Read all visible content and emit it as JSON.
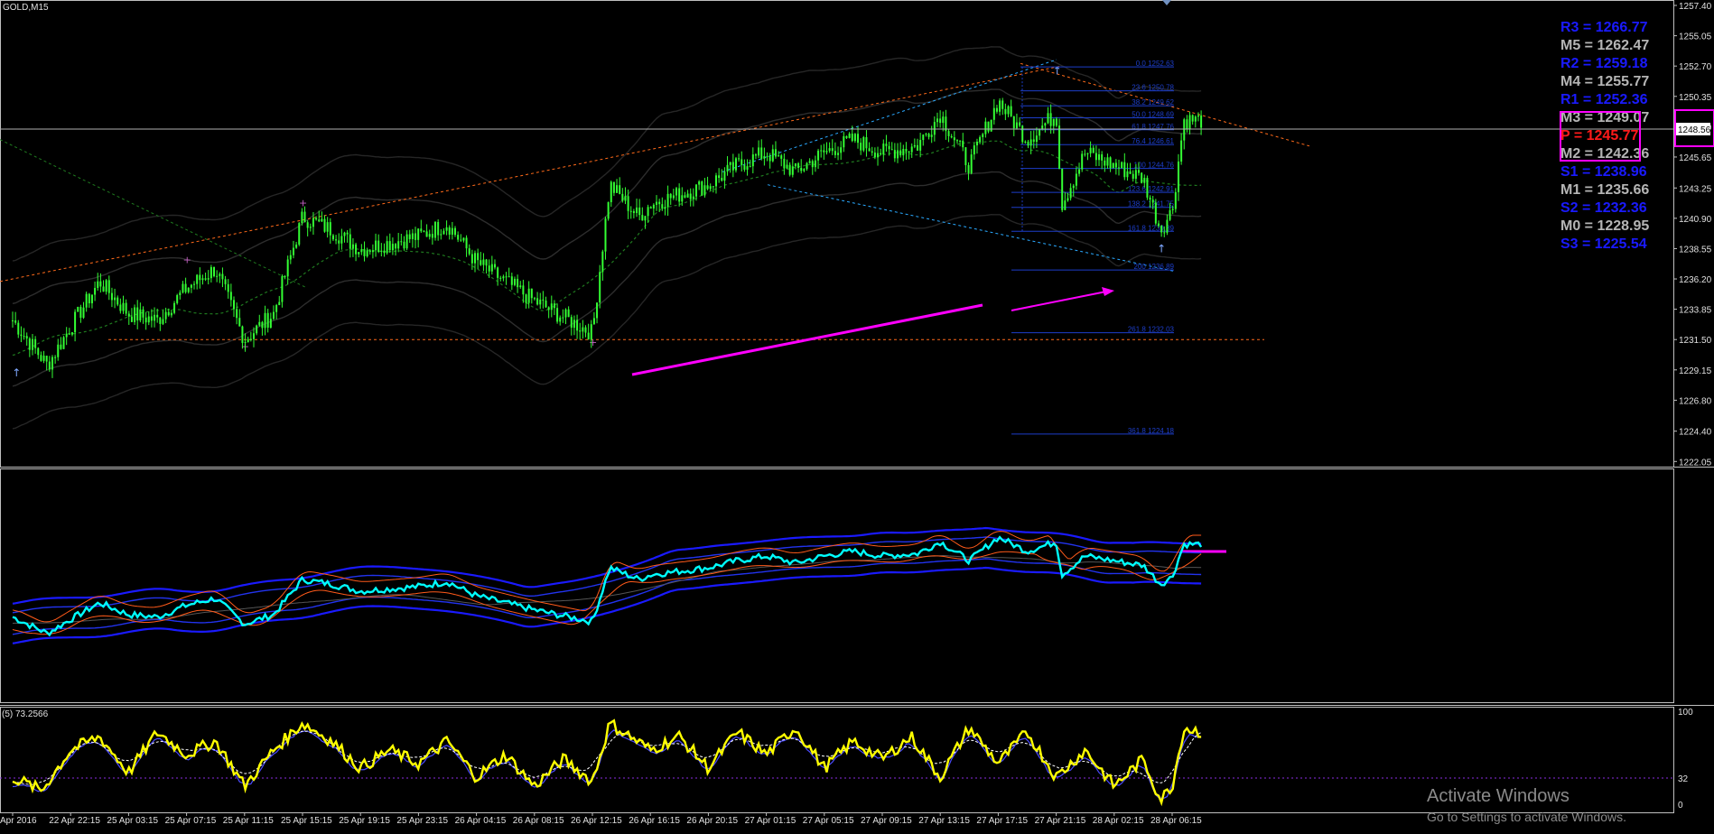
{
  "window": {
    "symbol_title": "GOLD,M15",
    "current_price_label": "1248.56"
  },
  "colors": {
    "background": "#000000",
    "candles": "#33ff33",
    "pivot_blue": "#1a1aff",
    "pivot_gray": "#b5b5b5",
    "pivot_red": "#ff1a1a",
    "highlight": "#ff00ff",
    "trend_orange": "#ff6a1a",
    "channel_cyan": "#2aa9ff",
    "rsi_cyan": "#00ffff",
    "stoch_yellow": "#ffff00"
  },
  "pivots": [
    {
      "label": "R3 = 1266.77",
      "color": "blue"
    },
    {
      "label": "M5 = 1262.47",
      "color": "gray"
    },
    {
      "label": "R2 = 1259.18",
      "color": "blue"
    },
    {
      "label": "M4 = 1255.77",
      "color": "gray"
    },
    {
      "label": "R1 = 1252.36",
      "color": "blue"
    },
    {
      "label": "M3 = 1249.07",
      "color": "gray"
    },
    {
      "label": "P = 1245.77",
      "color": "red"
    },
    {
      "label": "M2 = 1242.36",
      "color": "gray"
    },
    {
      "label": "S1 = 1238.96",
      "color": "blue"
    },
    {
      "label": "M1 = 1235.66",
      "color": "gray"
    },
    {
      "label": "S2 = 1232.36",
      "color": "blue"
    },
    {
      "label": "M0 = 1228.95",
      "color": "gray"
    },
    {
      "label": "S3 = 1225.54",
      "color": "blue"
    }
  ],
  "fib_levels": [
    "0.0 1252.63",
    "23.6 1250.78",
    "38.2 1249.62",
    "50.0 1248.69",
    "61.8 1247.76",
    "76.4 1246.61",
    "100 1244.76",
    "123.6 1242.91",
    "138.2 1241.75",
    "161.8 1239.89",
    "200 1236.89",
    "261.8 1232.03",
    "361.8 1224.18"
  ],
  "oscillator": {
    "label": "(5) 73.2566",
    "ticks": [
      "100",
      "32",
      "0"
    ]
  },
  "chart_data": [
    {
      "type": "candlestick",
      "title": "GOLD,M15",
      "ylim": [
        1222.0,
        1257.4
      ],
      "ylabel_ticks": [
        "1257.40",
        "1255.05",
        "1252.70",
        "1250.35",
        "1248.00",
        "1245.65",
        "1243.25",
        "1240.90",
        "1238.55",
        "1236.20",
        "1233.85",
        "1231.50",
        "1229.15",
        "1226.80",
        "1224.40",
        "1222.05"
      ],
      "x_ticks": [
        "Apr 2016",
        "22 Apr 22:15",
        "25 Apr 03:15",
        "25 Apr 07:15",
        "25 Apr 11:15",
        "25 Apr 15:15",
        "25 Apr 19:15",
        "25 Apr 23:15",
        "26 Apr 04:15",
        "26 Apr 08:15",
        "26 Apr 12:15",
        "26 Apr 16:15",
        "26 Apr 20:15",
        "27 Apr 01:15",
        "27 Apr 05:15",
        "27 Apr 09:15",
        "27 Apr 13:15",
        "27 Apr 17:15",
        "27 Apr 21:15",
        "28 Apr 02:15",
        "28 Apr 06:15"
      ],
      "close_anchors": [
        [
          0,
          1233.0
        ],
        [
          0.6,
          1229.5
        ],
        [
          1.0,
          1232.5
        ],
        [
          1.5,
          1236.0
        ],
        [
          2.0,
          1233.5
        ],
        [
          2.5,
          1233.0
        ],
        [
          3.0,
          1235.5
        ],
        [
          3.5,
          1237.0
        ],
        [
          4.0,
          1231.5
        ],
        [
          4.5,
          1233.5
        ],
        [
          5.0,
          1241.0
        ],
        [
          5.5,
          1240.0
        ],
        [
          6.0,
          1238.5
        ],
        [
          6.5,
          1239.0
        ],
        [
          7.0,
          1239.5
        ],
        [
          7.5,
          1240.5
        ],
        [
          8.0,
          1237.5
        ],
        [
          8.5,
          1236.0
        ],
        [
          9.0,
          1234.5
        ],
        [
          10.0,
          1232.0
        ],
        [
          10.3,
          1243.5
        ],
        [
          10.8,
          1241.0
        ],
        [
          11.0,
          1242.0
        ],
        [
          12.0,
          1243.5
        ],
        [
          12.5,
          1245.0
        ],
        [
          13.0,
          1246.0
        ],
        [
          13.5,
          1244.5
        ],
        [
          14.0,
          1246.0
        ],
        [
          14.5,
          1247.0
        ],
        [
          15.0,
          1246.0
        ],
        [
          15.6,
          1246.5
        ],
        [
          16.0,
          1249.0
        ],
        [
          16.5,
          1245.0
        ],
        [
          17.0,
          1250.0
        ],
        [
          17.5,
          1247.0
        ],
        [
          18.0,
          1249.0
        ],
        [
          18.1,
          1242.0
        ],
        [
          18.5,
          1246.0
        ],
        [
          19.0,
          1245.0
        ],
        [
          19.5,
          1244.0
        ],
        [
          19.8,
          1240.0
        ],
        [
          20.0,
          1241.5
        ],
        [
          20.2,
          1248.5
        ],
        [
          20.5,
          1248.5
        ]
      ],
      "osc_anchors": [
        [
          0,
          30
        ],
        [
          0.5,
          15
        ],
        [
          1.0,
          60
        ],
        [
          1.5,
          75
        ],
        [
          2.0,
          35
        ],
        [
          2.5,
          80
        ],
        [
          3.0,
          55
        ],
        [
          3.5,
          70
        ],
        [
          4.0,
          20
        ],
        [
          4.5,
          60
        ],
        [
          5.0,
          90
        ],
        [
          5.5,
          70
        ],
        [
          6.0,
          40
        ],
        [
          6.5,
          60
        ],
        [
          7.0,
          45
        ],
        [
          7.5,
          70
        ],
        [
          8.0,
          30
        ],
        [
          8.5,
          55
        ],
        [
          9.0,
          20
        ],
        [
          9.5,
          50
        ],
        [
          10.0,
          25
        ],
        [
          10.3,
          90
        ],
        [
          11.0,
          60
        ],
        [
          11.5,
          75
        ],
        [
          12.0,
          40
        ],
        [
          12.5,
          80
        ],
        [
          13.0,
          55
        ],
        [
          13.5,
          85
        ],
        [
          14.0,
          40
        ],
        [
          14.5,
          70
        ],
        [
          15.0,
          50
        ],
        [
          15.5,
          75
        ],
        [
          16.0,
          30
        ],
        [
          16.5,
          85
        ],
        [
          17.0,
          45
        ],
        [
          17.5,
          80
        ],
        [
          18.0,
          30
        ],
        [
          18.5,
          60
        ],
        [
          19.0,
          20
        ],
        [
          19.5,
          50
        ],
        [
          19.8,
          5
        ],
        [
          20.0,
          20
        ],
        [
          20.2,
          85
        ],
        [
          20.5,
          80
        ]
      ]
    }
  ]
}
